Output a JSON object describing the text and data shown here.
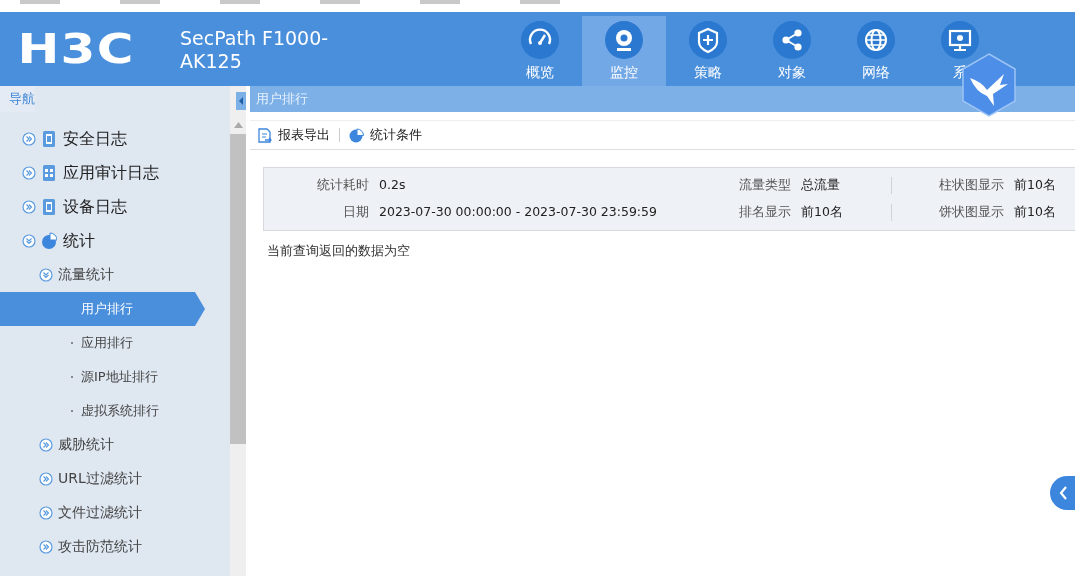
{
  "header": {
    "logo": "H3C",
    "product": "SecPath F1000-AK125",
    "tabs": [
      {
        "label": "概览",
        "selected": false
      },
      {
        "label": "监控",
        "selected": true
      },
      {
        "label": "策略",
        "selected": false
      },
      {
        "label": "对象",
        "selected": false
      },
      {
        "label": "网络",
        "selected": false
      },
      {
        "label": "系",
        "selected": false
      }
    ]
  },
  "sidebar": {
    "title": "导航",
    "items": [
      {
        "label": "安全日志",
        "kind": "log",
        "expanded": false
      },
      {
        "label": "应用审计日志",
        "kind": "audit",
        "expanded": false
      },
      {
        "label": "设备日志",
        "kind": "log",
        "expanded": false
      },
      {
        "label": "统计",
        "kind": "chart",
        "expanded": true,
        "children": [
          {
            "label": "流量统计",
            "expanded": true,
            "children": [
              {
                "label": "用户排行",
                "selected": true
              },
              {
                "label": "应用排行",
                "selected": false
              },
              {
                "label": "源IP地址排行",
                "selected": false
              },
              {
                "label": "虚拟系统排行",
                "selected": false
              }
            ]
          },
          {
            "label": "威胁统计",
            "expanded": false
          },
          {
            "label": "URL过滤统计",
            "expanded": false
          },
          {
            "label": "文件过滤统计",
            "expanded": false
          },
          {
            "label": "攻击防范统计",
            "expanded": false
          }
        ]
      }
    ]
  },
  "content": {
    "breadcrumb": "用户排行",
    "toolbar": [
      "报表导出",
      "统计条件"
    ],
    "summary": [
      {
        "label": "统计耗时",
        "value": "0.2s"
      },
      {
        "label": "流量类型",
        "value": "总流量"
      },
      {
        "label": "柱状图显示",
        "value": "前10名"
      },
      {
        "label": "日期",
        "value": "2023-07-30 00:00:00 - 2023-07-30 23:59:59"
      },
      {
        "label": "排名显示",
        "value": "前10名"
      },
      {
        "label": "饼状图显示",
        "value": "前10名"
      }
    ],
    "message": "当前查询返回的数据为空"
  }
}
